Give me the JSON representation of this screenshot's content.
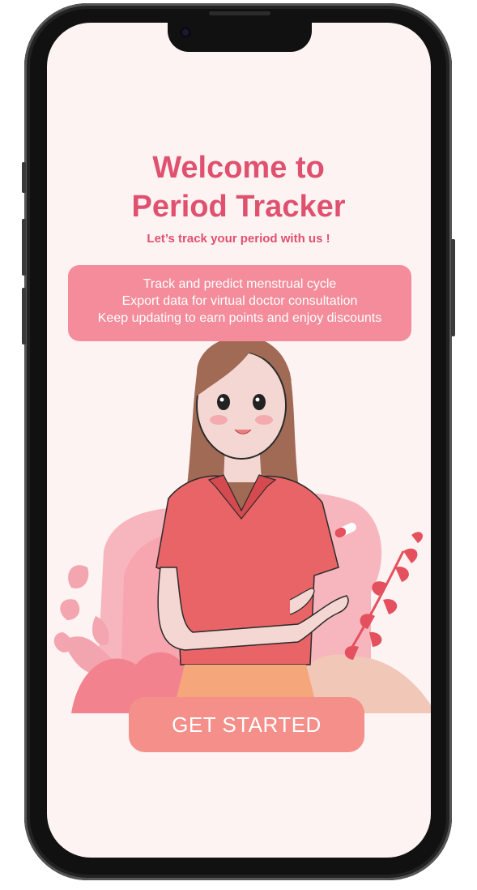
{
  "welcome": {
    "title_line1": "Welcome to",
    "title_line2": "Period Tracker",
    "subtitle": "Let’s track your period with us !"
  },
  "features": [
    "Track and predict menstrual cycle",
    "Export data for virtual doctor consultation",
    "Keep updating to earn points and enjoy discounts"
  ],
  "cta": {
    "label": "GET STARTED"
  },
  "colors": {
    "accent": "#e0516f",
    "feature_bg": "#f48c9b",
    "button_bg": "#f48f8a",
    "screen_bg": "#fdf3f2"
  },
  "icons": [
    "camera",
    "woman-illustration",
    "capsule-icon",
    "leaf-decoration"
  ]
}
